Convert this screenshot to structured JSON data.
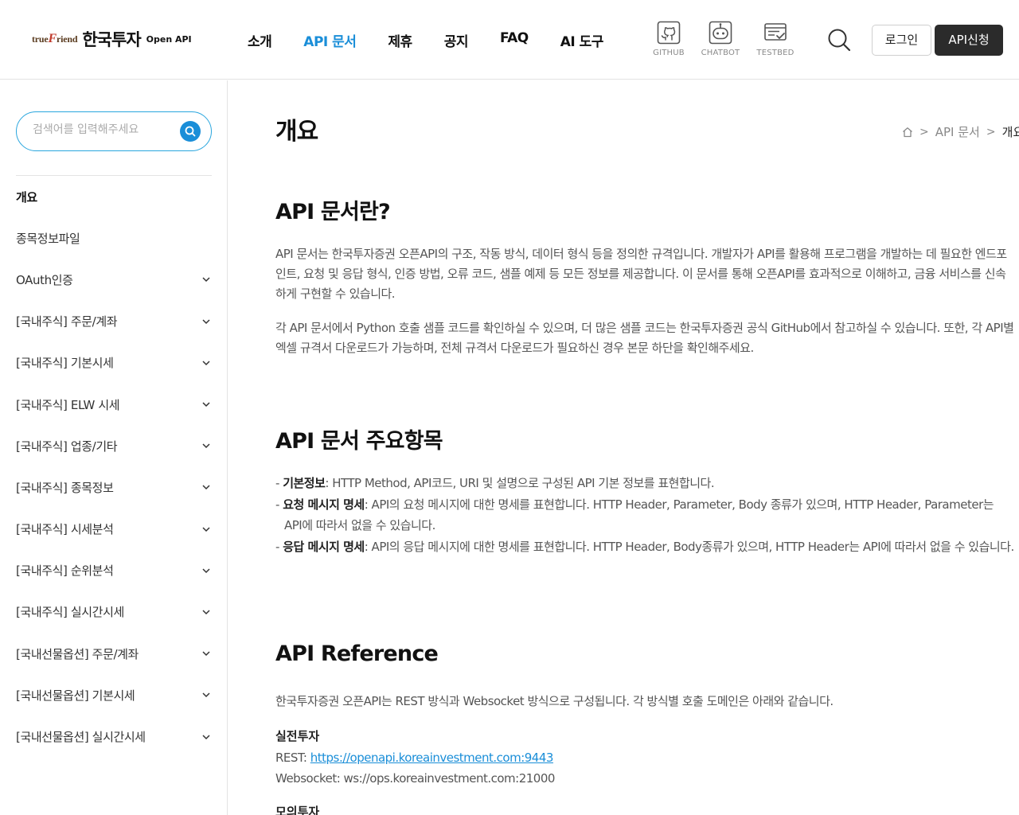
{
  "header": {
    "logo": {
      "brand_en_pre": "true",
      "brand_en_f": "F",
      "brand_en_post": "riend",
      "brand_ko": "한국투자",
      "brand_sub": "Open API"
    },
    "nav": [
      {
        "label": "소개"
      },
      {
        "label": "API 문서",
        "active": true
      },
      {
        "label": "제휴"
      },
      {
        "label": "공지"
      },
      {
        "label": "FAQ"
      },
      {
        "label": "AI 도구"
      }
    ],
    "tools": [
      {
        "label": "GITHUB",
        "icon": "github-icon"
      },
      {
        "label": "CHATBOT",
        "icon": "chatbot-icon"
      },
      {
        "label": "TESTBED",
        "icon": "testbed-icon"
      }
    ],
    "login_label": "로그인",
    "apply_label": "API신청"
  },
  "sidebar": {
    "search_placeholder": "검색어를 입력해주세요",
    "items": [
      {
        "label": "개요",
        "active": true
      },
      {
        "label": "종목정보파일"
      },
      {
        "label": "OAuth인증",
        "expandable": true
      },
      {
        "label": "[국내주식] 주문/계좌",
        "expandable": true
      },
      {
        "label": "[국내주식] 기본시세",
        "expandable": true
      },
      {
        "label": "[국내주식] ELW 시세",
        "expandable": true
      },
      {
        "label": "[국내주식] 업종/기타",
        "expandable": true
      },
      {
        "label": "[국내주식] 종목정보",
        "expandable": true
      },
      {
        "label": "[국내주식] 시세분석",
        "expandable": true
      },
      {
        "label": "[국내주식] 순위분석",
        "expandable": true
      },
      {
        "label": "[국내주식] 실시간시세",
        "expandable": true
      },
      {
        "label": "[국내선물옵션] 주문/계좌",
        "expandable": true
      },
      {
        "label": "[국내선물옵션] 기본시세",
        "expandable": true
      },
      {
        "label": "[국내선물옵션] 실시간시세",
        "expandable": true
      }
    ]
  },
  "content": {
    "title": "개요",
    "breadcrumb": {
      "section": "API 문서",
      "current": "개요"
    },
    "section1": {
      "heading": "API 문서란?",
      "p1": "API 문서는 한국투자증권 오픈API의 구조, 작동 방식, 데이터 형식 등을 정의한 규격입니다. 개발자가 API를 활용해 프로그램을 개발하는 데 필요한 엔드포인트, 요청 및 응답 형식, 인증 방법, 오류 코드, 샘플 예제 등 모든 정보를 제공합니다. 이 문서를 통해 오픈API를 효과적으로 이해하고, 금융 서비스를 신속하게 구현할 수 있습니다.",
      "p2": "각 API 문서에서 Python 호출 샘플 코드를 확인하실 수 있으며, 더 많은 샘플 코드는 한국투자증권 공식 GitHub에서 참고하실 수 있습니다. 또한, 각 API별 엑셀 규격서 다운로드가 가능하며, 전체 규격서 다운로드가 필요하신 경우 본문 하단을 확인해주세요."
    },
    "section2": {
      "heading": "API 문서 주요항목",
      "items": [
        {
          "term": "기본정보",
          "desc": ": HTTP Method, API코드, URI 및 설명으로 구성된 API 기본 정보를 표현합니다."
        },
        {
          "term": "요청 메시지 명세",
          "desc": ": API의 요청 메시지에 대한 명세를 표현합니다. HTTP Header, Parameter, Body 종류가 있으며, HTTP Header, Parameter는 API에 따라서 없을 수 있습니다."
        },
        {
          "term": "응답 메시지 명세",
          "desc": ": API의 응답 메시지에 대한 명세를 표현합니다. HTTP Header, Body종류가 있으며, HTTP Header는 API에 따라서 없을 수 있습니다."
        }
      ]
    },
    "section3": {
      "heading": "API Reference",
      "intro": "한국투자증권 오픈API는 REST 방식과 Websocket 방식으로 구성됩니다. 각 방식별 호출 도메인은 아래와 같습니다.",
      "real_heading": "실전투자",
      "rest_prefix": "REST: ",
      "rest_url": "https://openapi.koreainvestment.com:9443",
      "ws_line": "Websocket: ws://ops.koreainvestment.com:21000",
      "mock_heading": "모의투자"
    }
  }
}
